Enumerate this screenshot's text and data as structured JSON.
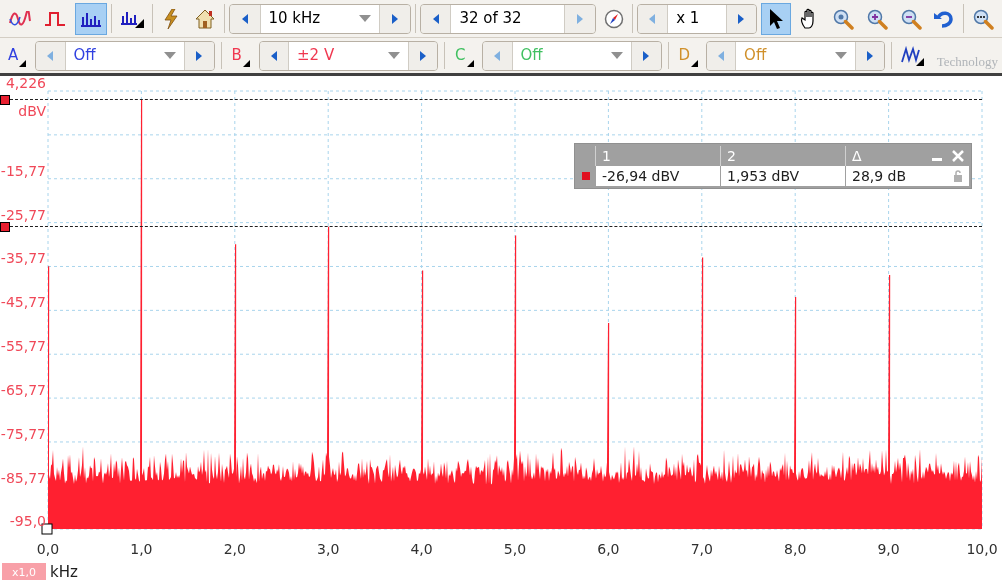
{
  "toolbar": {
    "modes": [
      {
        "kind": "scope",
        "selected": false
      },
      {
        "kind": "persistence",
        "selected": false
      },
      {
        "kind": "spectrum",
        "selected": true
      },
      {
        "kind": "spectrum-options",
        "selected": false
      }
    ],
    "timebase": {
      "value": "10 kHz"
    },
    "buffer": {
      "value": "32 of 32"
    },
    "zoom": {
      "value": "x 1"
    },
    "tools": [
      {
        "kind": "pointer",
        "selected": true
      },
      {
        "kind": "hand",
        "selected": false
      },
      {
        "kind": "zoom",
        "selected": false
      },
      {
        "kind": "zoom-in",
        "selected": false
      },
      {
        "kind": "zoom-out",
        "selected": false
      },
      {
        "kind": "undo",
        "selected": false
      },
      {
        "kind": "overview",
        "selected": false
      }
    ]
  },
  "channels": [
    {
      "letter": "A",
      "value": "Off",
      "color": "#3040e0"
    },
    {
      "letter": "B",
      "value": "±2 V",
      "color": "#f03850"
    },
    {
      "letter": "C",
      "value": "Off",
      "color": "#40c060"
    },
    {
      "letter": "D",
      "value": "Off",
      "color": "#d0902a"
    }
  ],
  "logo": "Technology",
  "measurements": {
    "columns": [
      "1",
      "2",
      "Δ"
    ],
    "row": {
      "color": "#e01020",
      "values": [
        "-26,94 dBV",
        "1,953 dBV",
        "28,9 dB"
      ]
    }
  },
  "plot": {
    "y_labels": [
      "4,226",
      "-15,77",
      "-25,77",
      "-35,77",
      "-45,77",
      "-55,77",
      "-65,77",
      "-75,77",
      "-85,77",
      "-95,0"
    ],
    "y_unit": "dBV",
    "x_labels": [
      "0,0",
      "1,0",
      "2,0",
      "3,0",
      "4,0",
      "5,0",
      "6,0",
      "7,0",
      "8,0",
      "9,0",
      "10,0"
    ],
    "x_unit": "kHz",
    "x_scale": "x1,0"
  }
}
